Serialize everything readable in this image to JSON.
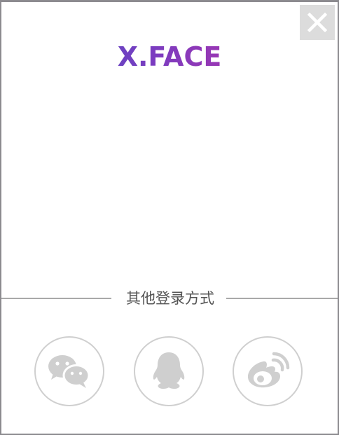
{
  "brand": {
    "logo_text": "X.FACE"
  },
  "close": {
    "icon": "close-icon",
    "label": "✕"
  },
  "divider": {
    "label": "其他登录方式"
  },
  "login_options": [
    {
      "id": "wechat",
      "icon": "wechat-icon"
    },
    {
      "id": "qq",
      "icon": "qq-icon"
    },
    {
      "id": "weibo",
      "icon": "weibo-icon"
    }
  ],
  "colors": {
    "border": "#8c8b8f",
    "close_bg": "#dcdcdc",
    "icon_gray": "#cfcfcf",
    "logo_gradient_start": "#3f55c6",
    "logo_gradient_end": "#cc2ea0"
  }
}
